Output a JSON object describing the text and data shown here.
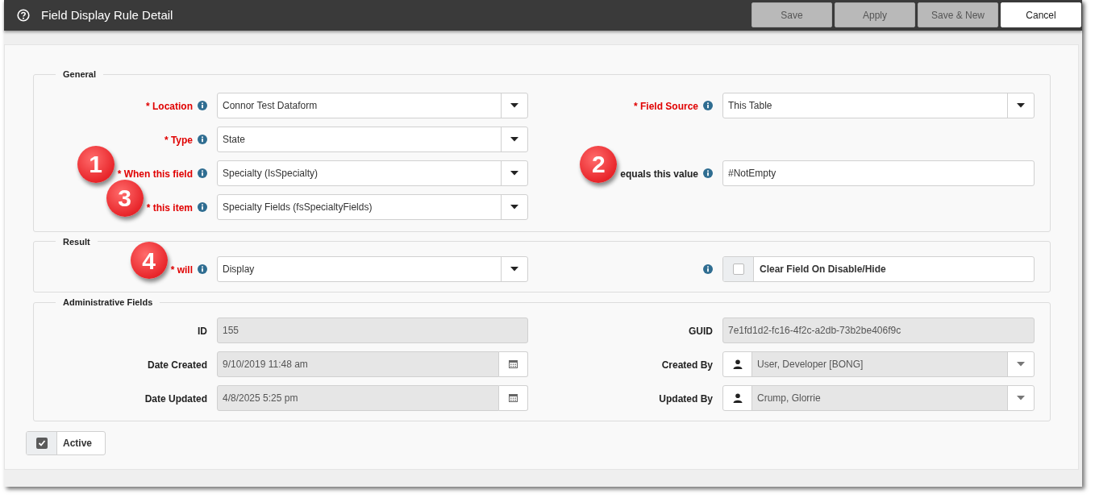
{
  "window": {
    "title": "Field Display Rule Detail"
  },
  "buttons": [
    {
      "label": "Save",
      "disabled": true
    },
    {
      "label": "Apply",
      "disabled": true
    },
    {
      "label": "Save & New",
      "disabled": true
    },
    {
      "label": "Cancel",
      "disabled": false
    }
  ],
  "sections": [
    {
      "title": "General",
      "rows": [
        {
          "left": {
            "label": "* Location",
            "required": true,
            "info": true,
            "kind": "select",
            "value": "Connor Test Dataform"
          },
          "right": {
            "label": "* Field Source",
            "required": true,
            "info": true,
            "kind": "select",
            "value": "This Table"
          }
        },
        {
          "left": {
            "label": "* Type",
            "required": true,
            "info": true,
            "kind": "select",
            "value": "State"
          }
        },
        {
          "left": {
            "label": "* When this field",
            "required": true,
            "info": true,
            "kind": "select",
            "value": "Specialty (IsSpecialty)",
            "callout": "1"
          },
          "right": {
            "label": "equals this value",
            "required": false,
            "info": true,
            "kind": "text",
            "value": "#NotEmpty",
            "callout": "2"
          }
        },
        {
          "left": {
            "label": "* this item",
            "required": true,
            "info": true,
            "kind": "select",
            "value": "Specialty Fields (fsSpecialtyFields)",
            "callout": "3"
          }
        }
      ]
    },
    {
      "title": "Result",
      "rows": [
        {
          "left": {
            "label": "* will",
            "required": true,
            "info": true,
            "kind": "select",
            "value": "Display",
            "callout": "4"
          },
          "right": {
            "info": true,
            "kind": "checkbox",
            "text": "Clear Field On Disable/Hide",
            "checked": false
          }
        }
      ]
    },
    {
      "title": "Administrative Fields",
      "rows": [
        {
          "left": {
            "label": "ID",
            "required": false,
            "info": false,
            "kind": "readonly",
            "value": "155"
          },
          "right": {
            "label": "GUID",
            "required": false,
            "info": false,
            "kind": "readonly",
            "value": "7e1fd1d2-fc16-4f2c-a2db-73b2be406f9c"
          }
        },
        {
          "left": {
            "label": "Date Created",
            "required": false,
            "info": false,
            "kind": "date",
            "value": "9/10/2019 11:48 am"
          },
          "right": {
            "label": "Created By",
            "required": false,
            "info": false,
            "kind": "user",
            "value": "User, Developer [BONG]"
          }
        },
        {
          "left": {
            "label": "Date Updated",
            "required": false,
            "info": false,
            "kind": "date",
            "value": "4/8/2025 5:25 pm"
          },
          "right": {
            "label": "Updated By",
            "required": false,
            "info": false,
            "kind": "user",
            "value": "Crump, Glorrie"
          }
        }
      ]
    }
  ],
  "active": {
    "label": "Active",
    "checked": true
  }
}
